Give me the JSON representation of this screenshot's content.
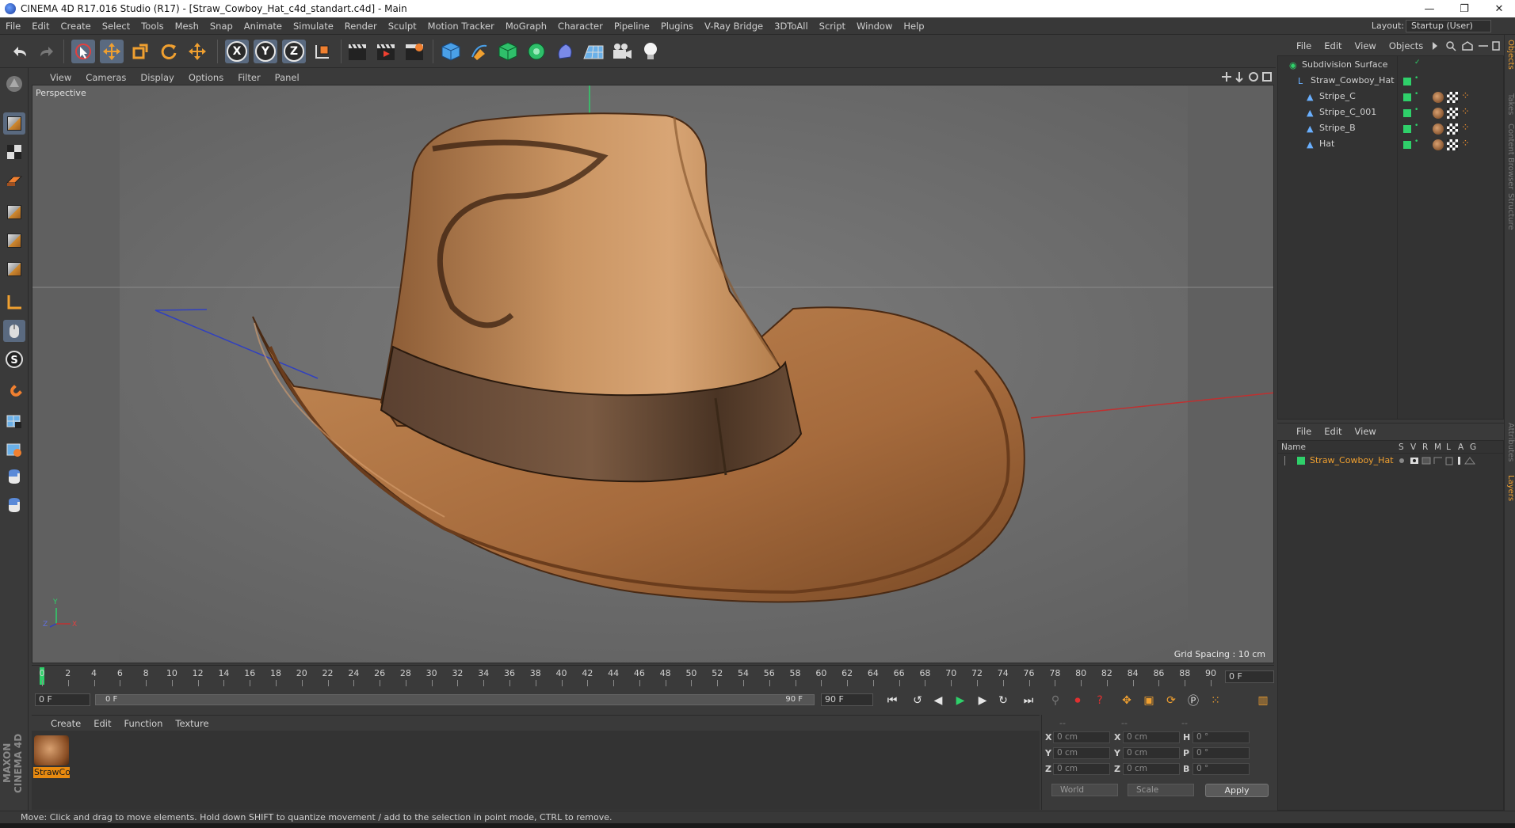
{
  "window": {
    "title": "CINEMA 4D R17.016 Studio (R17) - [Straw_Cowboy_Hat_c4d_standart.c4d] - Main",
    "minimize": "—",
    "restore": "❐",
    "close": "✕"
  },
  "menubar": {
    "items": [
      "File",
      "Edit",
      "Create",
      "Select",
      "Tools",
      "Mesh",
      "Snap",
      "Animate",
      "Simulate",
      "Render",
      "Sculpt",
      "Motion Tracker",
      "MoGraph",
      "Character",
      "Pipeline",
      "Plugins",
      "V-Ray Bridge",
      "3DToAll",
      "Script",
      "Window",
      "Help"
    ],
    "layout_label": "Layout:",
    "layout_value": "Startup (User)"
  },
  "toolbar": {
    "axis_x": "X",
    "axis_y": "Y",
    "axis_z": "Z"
  },
  "viewport": {
    "menu": [
      "View",
      "Cameras",
      "Display",
      "Options",
      "Filter",
      "Panel"
    ],
    "label": "Perspective",
    "grid_spacing": "Grid Spacing : 10 cm",
    "axis_x": "X",
    "axis_y": "Y",
    "axis_z": "Z"
  },
  "timeline": {
    "ticks": [
      0,
      2,
      4,
      6,
      8,
      10,
      12,
      14,
      16,
      18,
      20,
      22,
      24,
      26,
      28,
      30,
      32,
      34,
      36,
      38,
      40,
      42,
      44,
      46,
      48,
      50,
      52,
      54,
      56,
      58,
      60,
      62,
      64,
      66,
      68,
      70,
      72,
      74,
      76,
      78,
      80,
      82,
      84,
      86,
      88,
      90
    ],
    "current_frame": "0 F"
  },
  "transport": {
    "start_frame": "0 F",
    "range_start": "0 F",
    "range_end": "90 F",
    "end_frame": "90 F"
  },
  "material_manager": {
    "menu": [
      "Create",
      "Edit",
      "Function",
      "Texture"
    ],
    "material_name": "StrawCo"
  },
  "coordinates": {
    "header": [
      "--",
      "--",
      "--"
    ],
    "rows": [
      {
        "label_a": "X",
        "val_a": "0 cm",
        "label_b": "X",
        "val_b": "0 cm",
        "label_c": "H",
        "val_c": "0 °"
      },
      {
        "label_a": "Y",
        "val_a": "0 cm",
        "label_b": "Y",
        "val_b": "0 cm",
        "label_c": "P",
        "val_c": "0 °"
      },
      {
        "label_a": "Z",
        "val_a": "0 cm",
        "label_b": "Z",
        "val_b": "0 cm",
        "label_c": "B",
        "val_c": "0 °"
      }
    ],
    "mode": "World",
    "scale": "Scale",
    "apply": "Apply"
  },
  "object_manager": {
    "menu": [
      "File",
      "Edit",
      "View",
      "Objects"
    ],
    "objects": [
      {
        "name": "Subdivision Surface",
        "indent": 0
      },
      {
        "name": "Straw_Cowboy_Hat",
        "indent": 1
      },
      {
        "name": "Stripe_C",
        "indent": 2
      },
      {
        "name": "Stripe_C_001",
        "indent": 2
      },
      {
        "name": "Stripe_B",
        "indent": 2
      },
      {
        "name": "Hat",
        "indent": 2
      }
    ]
  },
  "layer_manager": {
    "menu": [
      "File",
      "Edit",
      "View"
    ],
    "columns": [
      "Name",
      "S",
      "V",
      "R",
      "M",
      "L",
      "A",
      "G"
    ],
    "layer_name": "Straw_Cowboy_Hat"
  },
  "side_tabs": [
    "Objects",
    "Takes",
    "Content Browser",
    "Structure",
    "Attributes",
    "Layers"
  ],
  "status": "Move: Click and drag to move elements. Hold down SHIFT to quantize movement / add to the selection in point mode, CTRL to remove.",
  "colors": {
    "accent": "#f0a030",
    "green": "#2fd06a",
    "hat_base": "#b57a45"
  }
}
